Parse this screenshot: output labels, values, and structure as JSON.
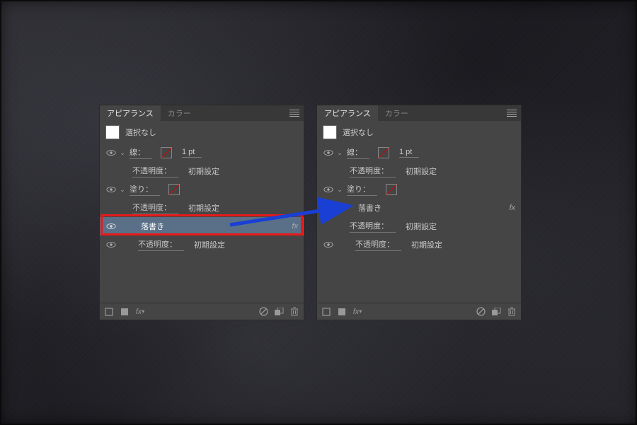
{
  "tabs": {
    "appearance": "アピアランス",
    "color": "カラー"
  },
  "selection": "選択なし",
  "stroke": {
    "label": "線：",
    "weight": "1 pt"
  },
  "fill": {
    "label": "塗り："
  },
  "opacity": {
    "label": "不透明度：",
    "value": "初期設定"
  },
  "effect": {
    "scribble": "落書き"
  },
  "fx": "fx",
  "icons": {
    "fx_footer": "fx"
  }
}
